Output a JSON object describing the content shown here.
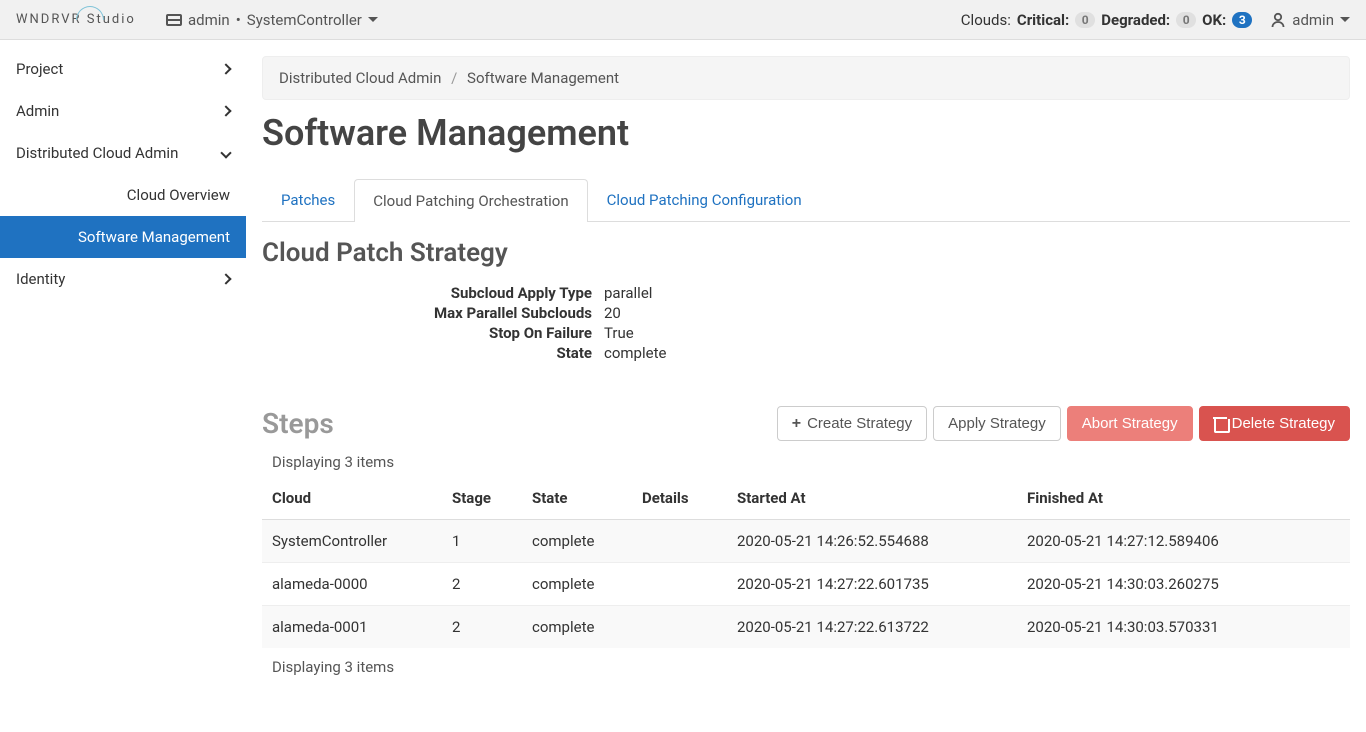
{
  "topbar": {
    "logo_text": "WNDRVR Studio",
    "domain_user": "admin",
    "domain_sep": "•",
    "domain_project": "SystemController",
    "clouds_label": "Clouds:",
    "critical_label": "Critical:",
    "critical_count": "0",
    "degraded_label": "Degraded:",
    "degraded_count": "0",
    "ok_label": "OK:",
    "ok_count": "3",
    "user_name": "admin"
  },
  "sidebar": {
    "items": [
      {
        "label": "Project"
      },
      {
        "label": "Admin"
      },
      {
        "label": "Distributed Cloud Admin"
      },
      {
        "label": "Identity"
      }
    ],
    "sub": [
      {
        "label": "Cloud Overview"
      },
      {
        "label": "Software Management"
      }
    ]
  },
  "breadcrumb": {
    "parent": "Distributed Cloud Admin",
    "current": "Software Management"
  },
  "page": {
    "title": "Software Management",
    "tabs": [
      {
        "label": "Patches"
      },
      {
        "label": "Cloud Patching Orchestration"
      },
      {
        "label": "Cloud Patching Configuration"
      }
    ],
    "section_title": "Cloud Patch Strategy",
    "strategy": {
      "apply_type_label": "Subcloud Apply Type",
      "apply_type_value": "parallel",
      "max_parallel_label": "Max Parallel Subclouds",
      "max_parallel_value": "20",
      "stop_on_failure_label": "Stop On Failure",
      "stop_on_failure_value": "True",
      "state_label": "State",
      "state_value": "complete"
    },
    "steps_title": "Steps",
    "buttons": {
      "create": "Create Strategy",
      "apply": "Apply Strategy",
      "abort": "Abort Strategy",
      "delete": "Delete Strategy"
    },
    "count_text": "Displaying 3 items",
    "columns": {
      "cloud": "Cloud",
      "stage": "Stage",
      "state": "State",
      "details": "Details",
      "started": "Started At",
      "finished": "Finished At"
    },
    "rows": [
      {
        "cloud": "SystemController",
        "stage": "1",
        "state": "complete",
        "details": "",
        "started": "2020-05-21 14:26:52.554688",
        "finished": "2020-05-21 14:27:12.589406"
      },
      {
        "cloud": "alameda-0000",
        "stage": "2",
        "state": "complete",
        "details": "",
        "started": "2020-05-21 14:27:22.601735",
        "finished": "2020-05-21 14:30:03.260275"
      },
      {
        "cloud": "alameda-0001",
        "stage": "2",
        "state": "complete",
        "details": "",
        "started": "2020-05-21 14:27:22.613722",
        "finished": "2020-05-21 14:30:03.570331"
      }
    ]
  }
}
